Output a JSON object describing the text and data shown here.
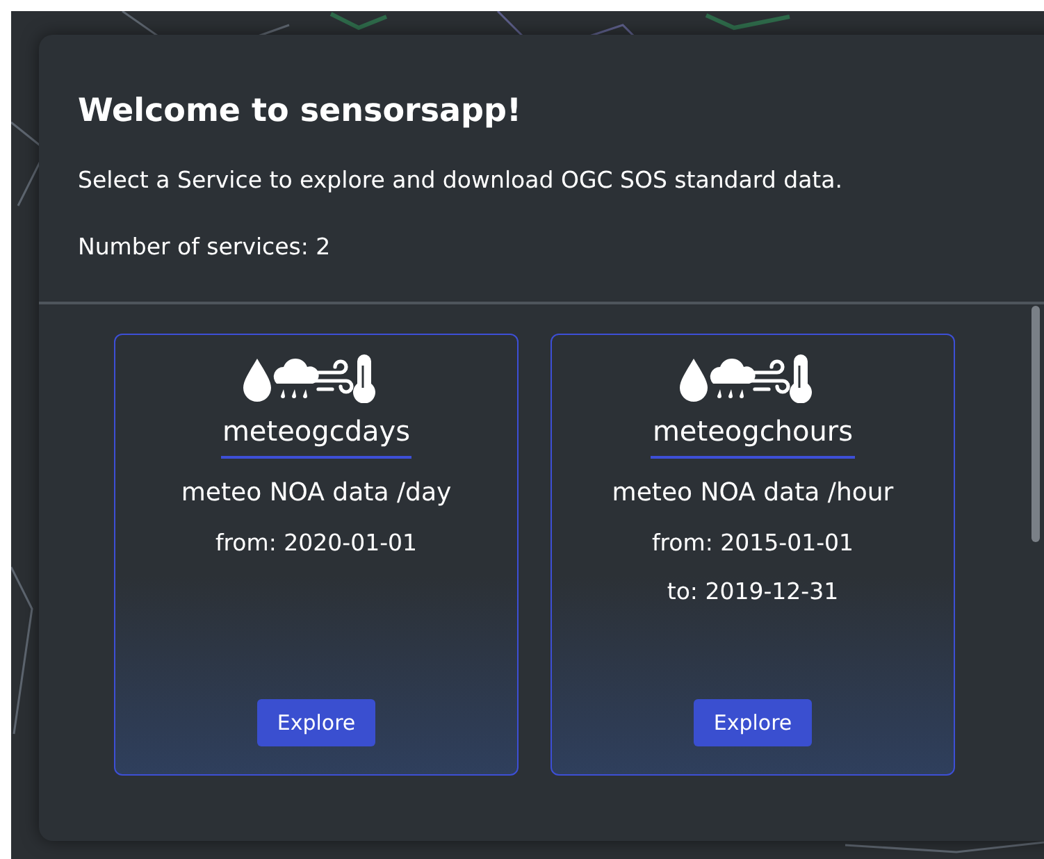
{
  "dialog": {
    "title": "Welcome to sensorsapp!",
    "intro": "Select a Service to explore and download OGC SOS standard data.",
    "count": "Number of services: 2"
  },
  "services": [
    {
      "name": "meteogcdays",
      "description": "meteo NOA data /day",
      "dates": [
        "from: 2020-01-01"
      ],
      "button": "Explore"
    },
    {
      "name": "meteogchours",
      "description": "meteo NOA data /hour",
      "dates": [
        "from: 2015-01-01",
        "to: 2019-12-31"
      ],
      "button": "Explore"
    }
  ]
}
